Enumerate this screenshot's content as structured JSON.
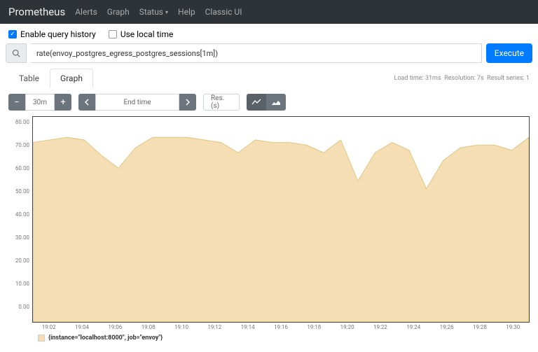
{
  "nav": {
    "brand": "Prometheus",
    "items": [
      "Alerts",
      "Graph",
      "Status",
      "Help",
      "Classic UI"
    ],
    "dropdown_index": 2
  },
  "opts": {
    "history": {
      "label": "Enable query history",
      "checked": true
    },
    "local": {
      "label": "Use local time",
      "checked": false
    }
  },
  "query": {
    "value": "rate(envoy_postgres_egress_postgres_sessions[1m])",
    "exec": "Execute"
  },
  "meta": {
    "load": "Load time: 31ms",
    "res": "Resolution: 7s",
    "series": "Result series: 1"
  },
  "tabs": {
    "table": "Table",
    "graph": "Graph"
  },
  "ctrl": {
    "range": "30m",
    "endtime": "End time",
    "res": "Res. (s)"
  },
  "legend": {
    "text": "{instance=\"localhost:8000\", job=\"envoy\"}"
  },
  "chart_data": {
    "type": "area",
    "title": "",
    "xlabel": "",
    "ylabel": "",
    "ylim": [
      0,
      80
    ],
    "y_ticks": [
      "80.00",
      "70.00",
      "60.00",
      "50.00",
      "40.00",
      "30.00",
      "20.00",
      "10.00",
      "0.00"
    ],
    "x_ticks": [
      "19:02",
      "19:04",
      "19:06",
      "19:08",
      "19:10",
      "19:12",
      "19:14",
      "19:16",
      "19:18",
      "19:20",
      "19:22",
      "19:24",
      "19:26",
      "19:28",
      "19:30"
    ],
    "series": [
      {
        "name": "{instance=\"localhost:8000\", job=\"envoy\"}",
        "x": [
          "19:01",
          "19:02",
          "19:03",
          "19:04",
          "19:05",
          "19:06",
          "19:07",
          "19:08",
          "19:09",
          "19:10",
          "19:11",
          "19:12",
          "19:13",
          "19:14",
          "19:15",
          "19:16",
          "19:17",
          "19:18",
          "19:19",
          "19:20",
          "19:21",
          "19:22",
          "19:23",
          "19:24",
          "19:25",
          "19:26",
          "19:27",
          "19:28",
          "19:29",
          "19:30"
        ],
        "values": [
          70,
          71,
          72,
          71,
          65,
          60,
          68,
          72,
          72,
          72,
          71,
          70,
          66,
          71,
          70,
          70,
          69,
          66,
          71,
          55,
          66,
          70,
          67,
          52,
          63,
          68,
          69,
          69,
          67,
          72
        ]
      }
    ],
    "color": "#f5deb3"
  }
}
